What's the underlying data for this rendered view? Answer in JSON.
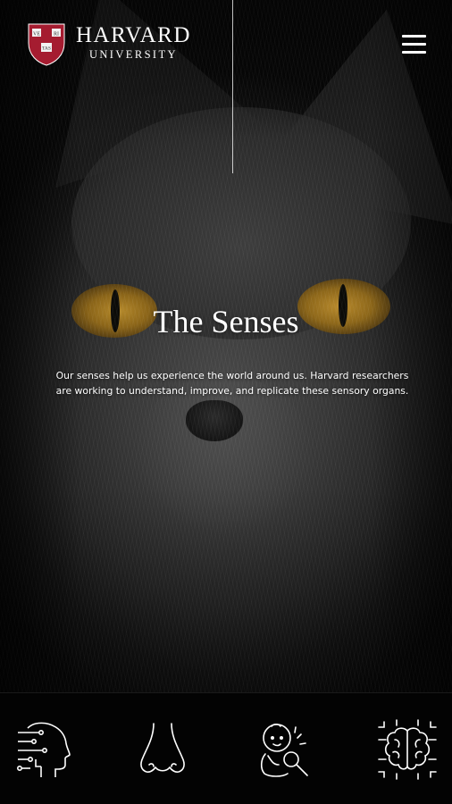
{
  "header": {
    "logo_main": "HARVARD",
    "logo_sub": "UNIVERSITY",
    "shield_text": [
      "VE",
      "RI",
      "TAS"
    ],
    "menu_icon": "hamburger-icon"
  },
  "hero": {
    "title": "The Senses",
    "description": "Our senses help us experience the world around us. Harvard researchers are working to understand, improve, and replicate these sensory organs."
  },
  "senses_nav": {
    "items": [
      {
        "icon": "head-circuit-icon"
      },
      {
        "icon": "nose-icon"
      },
      {
        "icon": "baby-magnifier-icon"
      },
      {
        "icon": "brain-circuit-icon"
      }
    ]
  },
  "colors": {
    "crimson": "#a51c30",
    "white": "#ffffff",
    "background": "#000000",
    "eye_amber": "#b5892a"
  }
}
